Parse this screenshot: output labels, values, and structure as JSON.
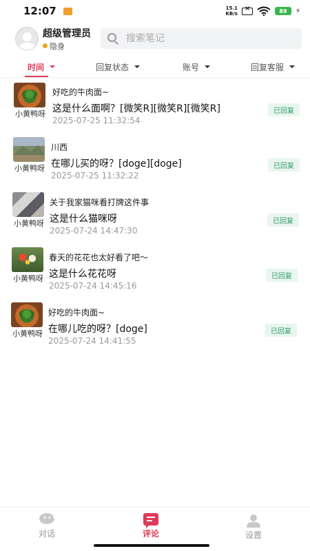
{
  "status_bar": {
    "time": "12:07",
    "net_speed_value": "15.1",
    "net_speed_unit": "KB/s",
    "battery": "89"
  },
  "header": {
    "user_name": "超级管理员",
    "user_status": "隐身",
    "search_placeholder": "搜索笔记"
  },
  "filters": [
    {
      "label": "时间"
    },
    {
      "label": "回复状态"
    },
    {
      "label": "账号"
    },
    {
      "label": "回复客服"
    }
  ],
  "comments": [
    {
      "thumb": "noodle",
      "author": "小黄鸭呀",
      "post_title": "好吃的牛肉面~",
      "text": "这是什么面啊？[微笑R][微笑R][微笑R]",
      "time": "2025-07-25 11:32:54",
      "status": "已回复"
    },
    {
      "thumb": "mountain",
      "author": "小黄鸭呀",
      "post_title": "川西",
      "text": "在哪儿买的呀？[doge][doge]",
      "time": "2025-07-25 11:32:22",
      "status": "已回复"
    },
    {
      "thumb": "cat",
      "author": "小黄鸭呀",
      "post_title": "关于我家猫咪看打牌这件事",
      "text": "这是什么猫咪呀",
      "time": "2025-07-24 14:47:30",
      "status": "已回复"
    },
    {
      "thumb": "flowers",
      "author": "小黄鸭呀",
      "post_title": "春天的花花也太好看了吧～",
      "text": "这是什么花花呀",
      "time": "2025-07-24 14:45:16",
      "status": "已回复"
    },
    {
      "thumb": "noodle",
      "author": "小黄鸭呀",
      "post_title": "好吃的牛肉面~",
      "text": "在哪儿吃的呀？[doge]",
      "time": "2025-07-24 14:41:55",
      "status": "已回复"
    }
  ],
  "tabs": [
    {
      "label": "对话",
      "icon": "chat-icon"
    },
    {
      "label": "评论",
      "icon": "comment-icon"
    },
    {
      "label": "设置",
      "icon": "person-icon"
    }
  ],
  "colors": {
    "accent": "#e03a5a",
    "replied_text": "#2e9b63",
    "replied_bg": "#e8f6ee"
  }
}
